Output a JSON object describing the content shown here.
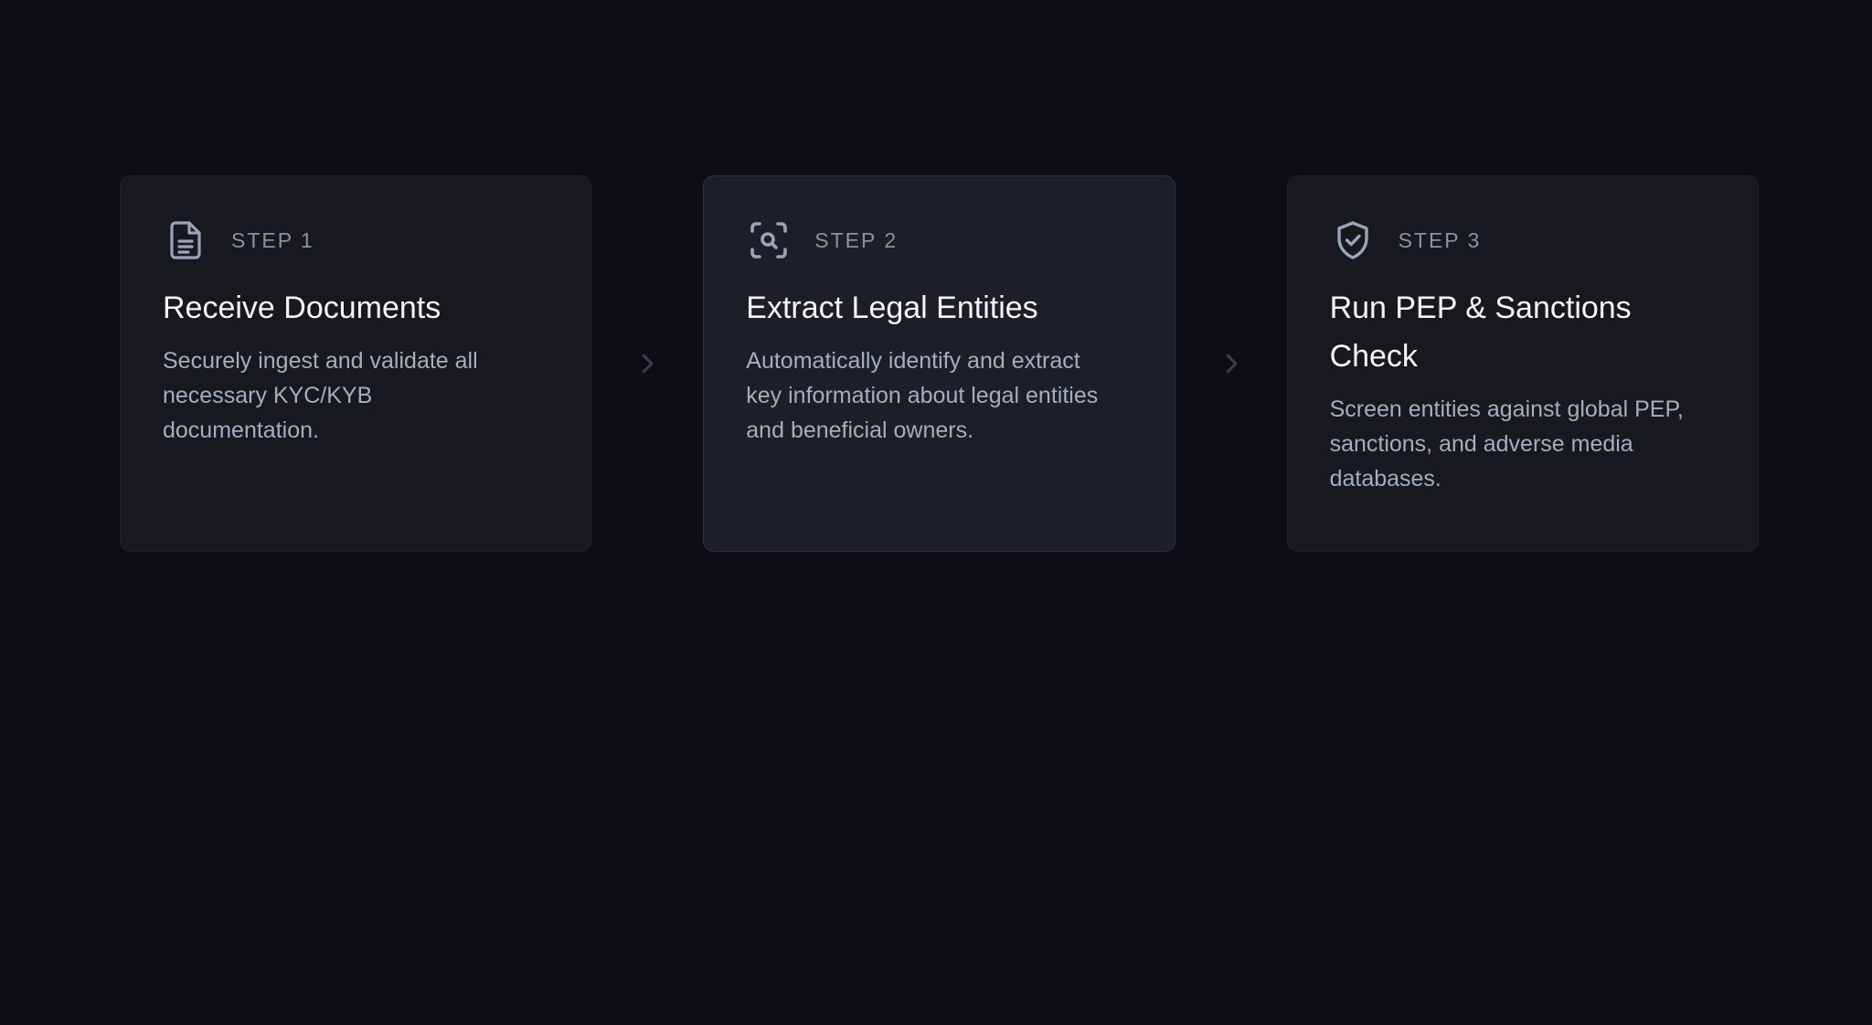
{
  "steps": [
    {
      "label": "STEP 1",
      "title": "Receive Documents",
      "description": "Securely ingest and validate all necessary KYC/KYB documentation.",
      "icon": "document-icon"
    },
    {
      "label": "STEP 2",
      "title": "Extract Legal Entities",
      "description": "Automatically identify and extract key information about legal entities and beneficial owners.",
      "icon": "scan-search-icon"
    },
    {
      "label": "STEP 3",
      "title": "Run PEP & Sanctions Check",
      "description": "Screen entities against global PEP, sanctions, and adverse media databases.",
      "icon": "shield-check-icon"
    }
  ],
  "active_step": 2,
  "colors": {
    "background": "#0c0e13",
    "card": "#17191e",
    "card_active": "#1c1f27",
    "title": "#f3f5f8",
    "text": "#a3aebf",
    "muted": "#8a93a4",
    "arrow": "#3a404b"
  }
}
